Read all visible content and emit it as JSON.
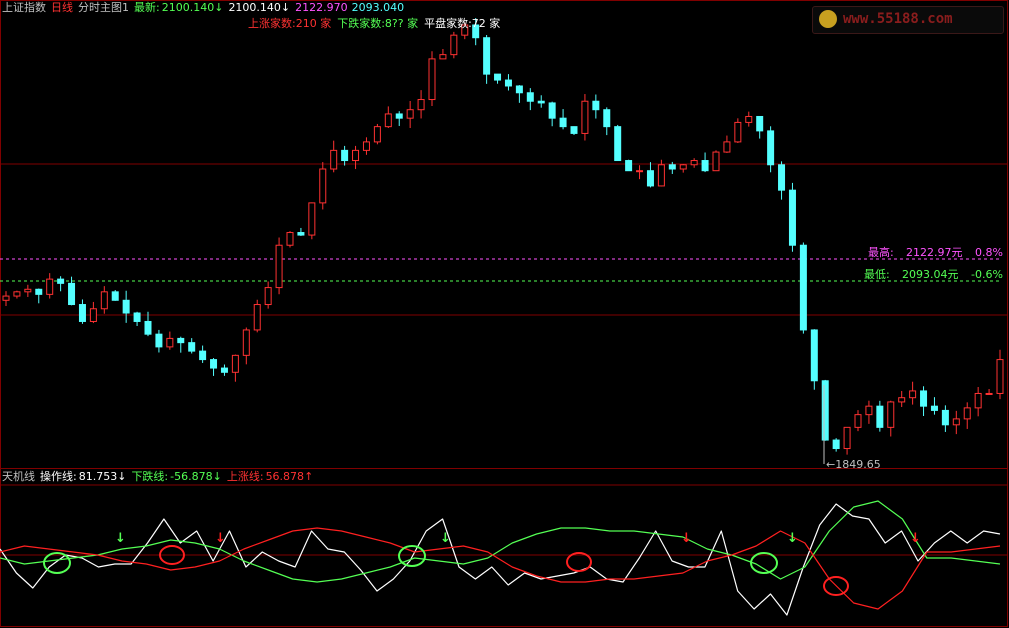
{
  "header": {
    "index_name": "上证指数",
    "period": "日线",
    "chart_mode": "分时主图1",
    "latest_label": "最新:",
    "latest_value": "2100.140",
    "latest_arrow": "↓",
    "latest_value2": "2100.140↓",
    "high_value": "2122.970",
    "low_value": "2093.040",
    "rise_count_text": "上涨家数:210 家",
    "fall_count_text": "下跌家数:8?? 家",
    "flat_count_text": "平盘家数:72 家"
  },
  "watermark": {
    "text": "www.55188.com"
  },
  "annotations": {
    "high_label": "最高:",
    "high_price": "2122.97元",
    "high_pct": "0.8%",
    "low_label": "最低:",
    "low_price": "2093.04元",
    "low_pct": "-0.6%",
    "bottom_marker": "←1849.65"
  },
  "indicator": {
    "name": "天机线",
    "op_label": "操作线:",
    "op_value": "81.753",
    "op_arrow": "↓",
    "fall_label": "下跌线:",
    "fall_value": "-56.878",
    "fall_arrow": "↓",
    "rise_label": "上涨线:",
    "rise_value": "56.878",
    "rise_arrow": "↑"
  },
  "colors": {
    "up": "#ff3232",
    "down": "#54ffff",
    "green": "#54ff54",
    "magenta": "#ff54ff",
    "grid": "#800000",
    "white": "#ffffff",
    "red": "#ff2020"
  },
  "chart_data": [
    {
      "type": "candlestick",
      "title": "上证指数 日线",
      "xlabel": "",
      "ylabel": "",
      "approx_close": [
        2090,
        2095,
        2098,
        2092,
        2110,
        2105,
        2080,
        2060,
        2075,
        2095,
        2085,
        2070,
        2060,
        2045,
        2030,
        2040,
        2035,
        2025,
        2015,
        2005,
        2000,
        2020,
        2050,
        2080,
        2100,
        2150,
        2165,
        2162,
        2200,
        2240,
        2262,
        2250,
        2262,
        2272,
        2290,
        2305,
        2300,
        2310,
        2322,
        2370,
        2375,
        2398,
        2410,
        2395,
        2352,
        2345,
        2338,
        2330,
        2320,
        2318,
        2300,
        2290,
        2282,
        2320,
        2310,
        2290,
        2250,
        2238,
        2238,
        2220,
        2245,
        2240,
        2245,
        2250,
        2238,
        2260,
        2272,
        2295,
        2302,
        2285,
        2245,
        2215,
        2150,
        2050,
        1990,
        1920,
        1910,
        1935,
        1950,
        1960,
        1935,
        1965,
        1970,
        1978,
        1960,
        1955,
        1938,
        1945,
        1958,
        1975,
        1975,
        2015
      ],
      "reference_lines": [
        {
          "label": "最高",
          "value": 2122.97
        },
        {
          "label": "最低",
          "value": 2093.04
        }
      ],
      "period_low": 1849.65,
      "grid": true
    },
    {
      "type": "line",
      "title": "天机线",
      "series": [
        {
          "name": "操作线",
          "last": 81.753,
          "values": [
            10,
            -30,
            -55,
            -20,
            0,
            -5,
            -20,
            -15,
            -15,
            20,
            60,
            20,
            40,
            -10,
            40,
            -20,
            5,
            -10,
            -20,
            40,
            10,
            5,
            -25,
            -60,
            -40,
            -10,
            40,
            60,
            -20,
            -40,
            -20,
            -50,
            -30,
            -40,
            -35,
            -30,
            -20,
            -40,
            -45,
            -5,
            40,
            -10,
            -20,
            -20,
            40,
            -60,
            -90,
            -65,
            -100,
            -20,
            50,
            85,
            65,
            60,
            20,
            40,
            -10,
            20,
            40,
            20,
            40,
            35
          ]
        },
        {
          "name": "下跌线",
          "last": -56.878,
          "values": [
            -5,
            -15,
            -10,
            -5,
            0,
            10,
            15,
            25,
            20,
            10,
            -10,
            -25,
            -40,
            -45,
            -40,
            -30,
            -20,
            -5,
            -10,
            -15,
            -5,
            20,
            35,
            45,
            45,
            40,
            40,
            35,
            30,
            10,
            0,
            -15,
            -40,
            -20,
            40,
            80,
            90,
            60,
            -5,
            -5,
            -10,
            -15
          ]
        },
        {
          "name": "上涨线",
          "last": 56.878,
          "values": [
            5,
            15,
            10,
            5,
            0,
            -10,
            -15,
            -25,
            -20,
            -10,
            10,
            25,
            40,
            45,
            40,
            30,
            20,
            5,
            10,
            15,
            5,
            -20,
            -35,
            -45,
            -45,
            -40,
            -40,
            -35,
            -30,
            -10,
            0,
            15,
            40,
            20,
            -40,
            -80,
            -90,
            -60,
            5,
            5,
            10,
            15
          ]
        }
      ],
      "signals": {
        "buy_arrows": 4,
        "sell_arrows": 3,
        "green_circles": 3,
        "red_circles": 3
      },
      "grid": true
    }
  ]
}
